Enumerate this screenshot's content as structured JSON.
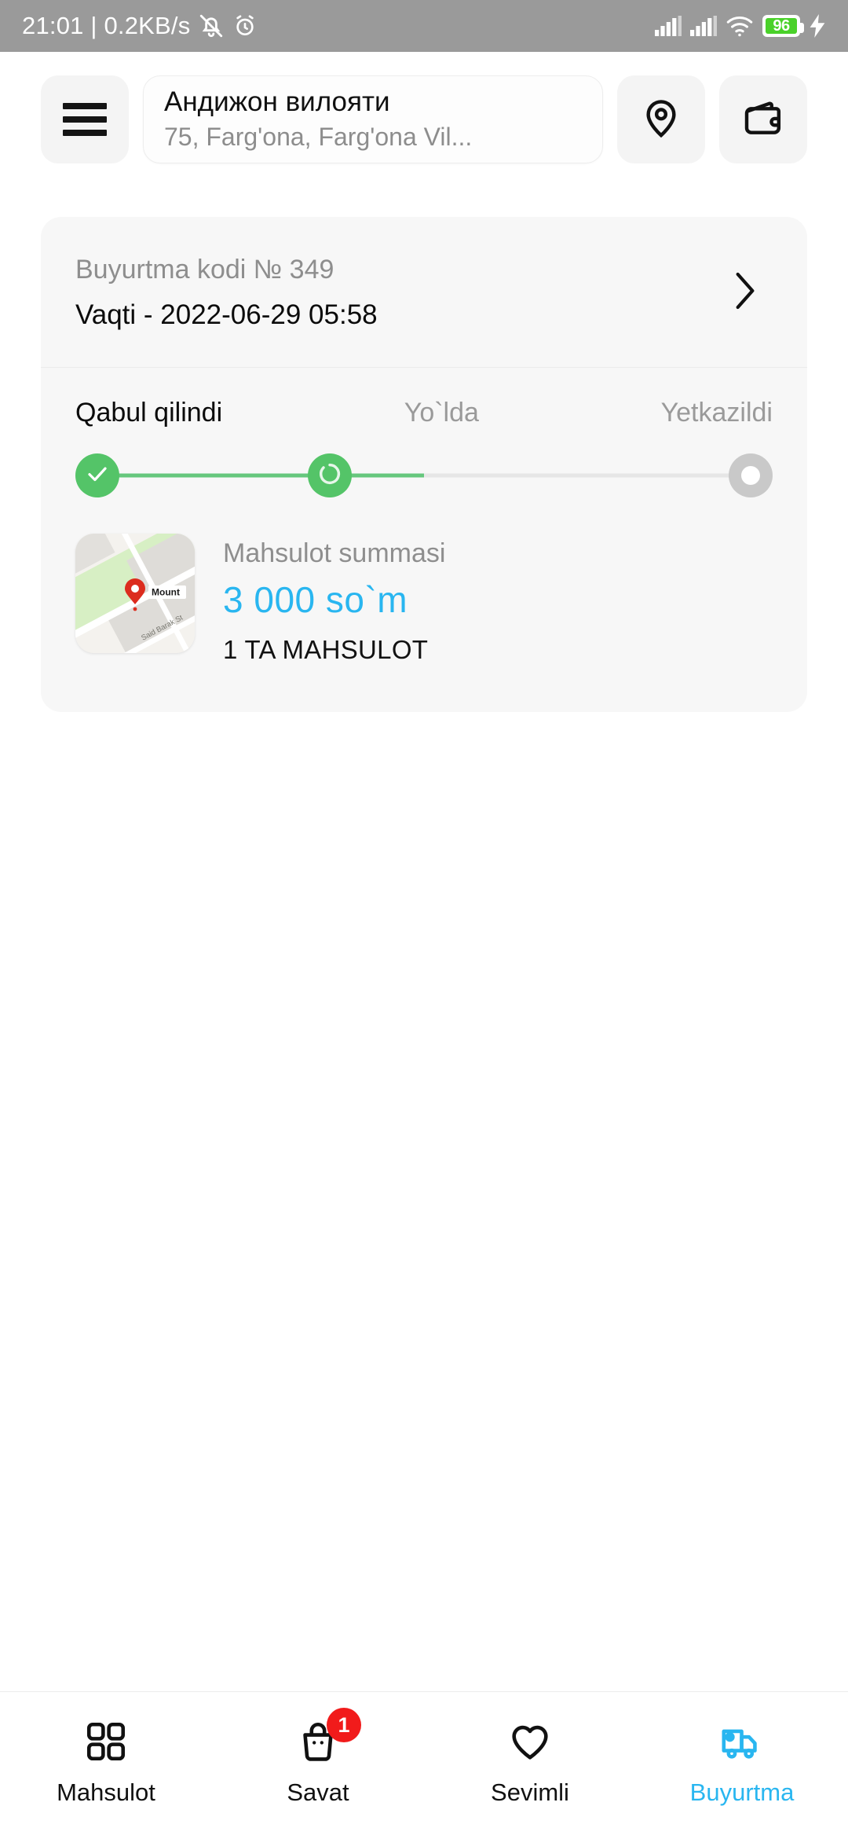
{
  "status_bar": {
    "clock": "21:01 | 0.2KB/s",
    "mute_icon": "bell-muted-icon",
    "alarm_icon": "alarm-clock-icon",
    "signal_icons": [
      "signal-bars-icon",
      "signal-bars-icon"
    ],
    "wifi_icon": "wifi-icon",
    "battery_level": "96",
    "charging_icon": "charging-bolt-icon",
    "bg_color": "#9a9a9a"
  },
  "header": {
    "menu_icon": "hamburger-menu-icon",
    "address": {
      "title": "Андижон вилояти",
      "subtitle": "75, Farg'ona, Farg'ona Vil..."
    },
    "location_icon": "location-pin-icon",
    "wallet_icon": "wallet-icon"
  },
  "order_card": {
    "code_label": "Buyurtma kodi  № 349",
    "time_label": "Vaqti - 2022-06-29 05:58",
    "chevron_icon": "chevron-right-icon",
    "steps": [
      {
        "label": "Qabul qilindi",
        "state": "done",
        "icon": "check-icon"
      },
      {
        "label": "Yo`lda",
        "state": "active",
        "icon": "spinner-icon"
      },
      {
        "label": "Yetkazildi",
        "state": "pending",
        "icon": "empty-circle-icon"
      }
    ],
    "summary": {
      "map_thumbnail": {
        "place_label": "Mount",
        "street_label": "Said Barak St",
        "pin_icon": "map-pin-icon"
      },
      "title": "Mahsulot summasi",
      "price": "3 000 so`m",
      "count": "1 TA MAHSULOT"
    }
  },
  "bottom_nav": {
    "items": [
      {
        "label": "Mahsulot",
        "icon": "grid-icon",
        "badge": "",
        "active": false
      },
      {
        "label": "Savat",
        "icon": "shopping-bag-icon",
        "badge": "1",
        "active": false
      },
      {
        "label": "Sevimli",
        "icon": "heart-icon",
        "badge": "",
        "active": false
      },
      {
        "label": "Buyurtma",
        "icon": "delivery-truck-icon",
        "badge": "",
        "active": true
      }
    ]
  },
  "colors": {
    "accent": "#29b6f0",
    "success": "#54c468",
    "danger": "#f11b1b",
    "status_bar": "#9a9a9a",
    "card_bg": "#f7f7f7"
  }
}
